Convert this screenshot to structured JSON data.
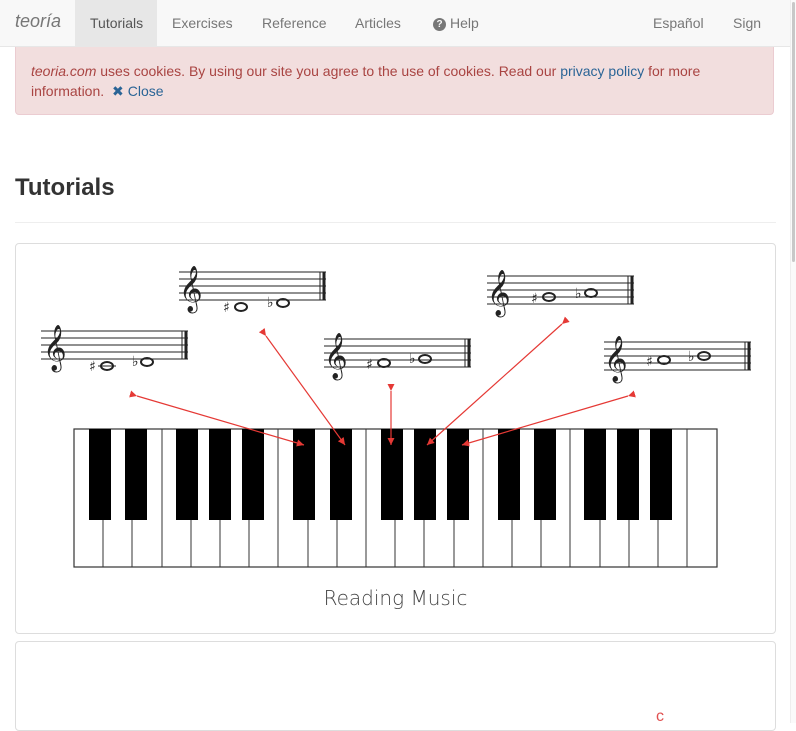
{
  "nav": {
    "brand": "teoría",
    "items": [
      {
        "label": "Tutorials",
        "active": true
      },
      {
        "label": "Exercises",
        "active": false
      },
      {
        "label": "Reference",
        "active": false
      },
      {
        "label": "Articles",
        "active": false
      },
      {
        "label": "Help",
        "icon": "question-circle-icon",
        "active": false
      }
    ],
    "right": [
      {
        "label": "Español"
      },
      {
        "label": "Sign in"
      }
    ]
  },
  "cookie_alert": {
    "site": "teoria.com",
    "text_before_link": " uses cookies. By using our site you agree to the use of cookies. Read our ",
    "link_text": "privacy policy",
    "text_after_link": " for more information.",
    "close_icon": "close-x-icon",
    "close_label": "Close",
    "colors": {
      "background": "#f2dede",
      "text": "#a94442",
      "link": "#2a6496"
    }
  },
  "page": {
    "title": "Tutorials"
  },
  "cards": [
    {
      "caption": "Reading Music",
      "image": "piano-keyboard-with-staff-notation-illustration",
      "arrow_color": "#e53935"
    },
    {
      "caption": "",
      "image": "partially-visible-card"
    }
  ]
}
